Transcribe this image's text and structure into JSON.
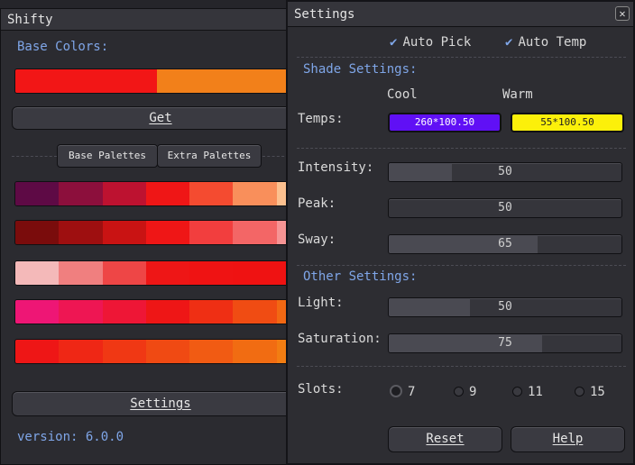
{
  "shifty": {
    "title": "Shifty",
    "base_colors_label": "Base Colors:",
    "base_colors": [
      "#f21616",
      "#f2801a"
    ],
    "get_label": "Get",
    "tabs": [
      "Base Palettes",
      "Extra Palettes"
    ],
    "palettes": [
      [
        "#5e0a45",
        "#8c0f3c",
        "#bd1230",
        "#ef1616",
        "#f44b30",
        "#f98f5b",
        "#fcc08f"
      ],
      [
        "#7a0c0c",
        "#9e0f10",
        "#c91313",
        "#ef1616",
        "#f23e3e",
        "#f36666",
        "#f69494"
      ],
      [
        "#f4b9b9",
        "#f07f7f",
        "#ee4646",
        "#ee1616",
        "#ef1313",
        "#ef1212",
        "#ef1212"
      ],
      [
        "#ee1675",
        "#ee1653",
        "#ee1636",
        "#ee1616",
        "#ef2f14",
        "#f04c13",
        "#f26813"
      ],
      [
        "#ee1616",
        "#ef2715",
        "#f03814",
        "#f04a13",
        "#f15b13",
        "#f16c12",
        "#f27d12"
      ]
    ],
    "settings_label": "Settings",
    "version": "version: 6.0.0"
  },
  "settings": {
    "title": "Settings",
    "close_glyph": "✕",
    "check_glyph": "✔",
    "auto_pick": "Auto Pick",
    "auto_temp": "Auto Temp",
    "shade_title": "Shade Settings:",
    "cool_label": "Cool",
    "warm_label": "Warm",
    "temps_label": "Temps:",
    "cool_value": "260*100.50",
    "warm_value": "55*100.50",
    "cool_color": "#6010f5",
    "warm_color": "#fcf00a",
    "intensity_label": "Intensity:",
    "intensity_value": 50,
    "peak_label": "Peak:",
    "peak_value": 50,
    "sway_label": "Sway:",
    "sway_value": 65,
    "other_title": "Other Settings:",
    "light_label": "Light:",
    "light_value": 50,
    "saturation_label": "Saturation:",
    "saturation_value": 75,
    "slots_label": "Slots:",
    "slots": [
      "7",
      "9",
      "11",
      "15"
    ],
    "selected_slot": "7",
    "reset_label": "Reset",
    "help_label": "Help",
    "slider_fills": {
      "intensity": 0.27,
      "peak": 0.0,
      "sway": 0.64,
      "light": 0.35,
      "saturation": 0.66
    }
  }
}
